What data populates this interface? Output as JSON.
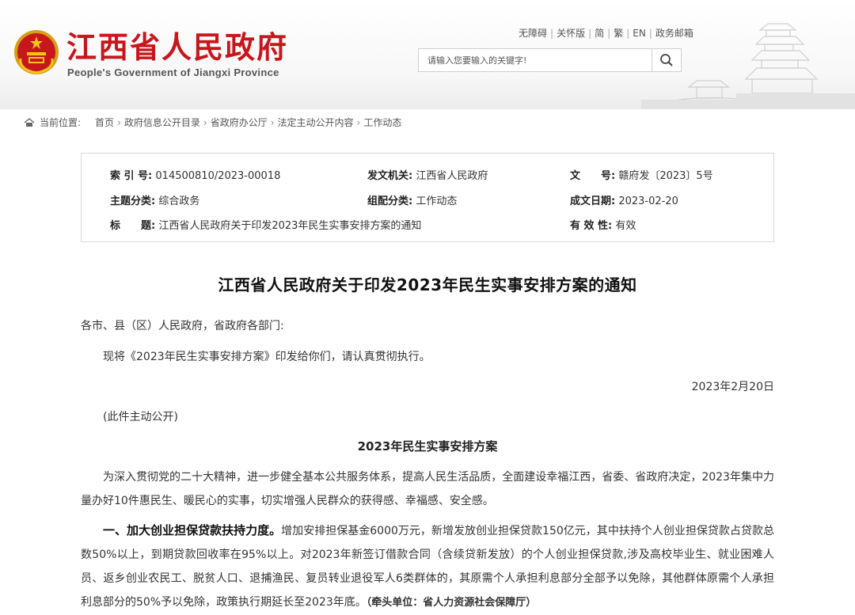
{
  "header": {
    "site_name": "江西省人民政府",
    "site_name_en": "People's Government of Jiangxi Province",
    "top_links": [
      "无障碍",
      "关怀版",
      "简",
      "繁",
      "EN",
      "政务邮箱"
    ],
    "search_placeholder": "请输入您要输入的关键字!"
  },
  "breadcrumb": {
    "label": "当前位置:",
    "items": [
      "首页",
      "政府信息公开目录",
      "省政府办公厅",
      "法定主动公开内容",
      "工作动态"
    ]
  },
  "meta": {
    "index_no_label": "索 引 号:",
    "index_no": "014500810/2023-00018",
    "issuer_label": "发文机关:",
    "issuer": "江西省人民政府",
    "doc_no_label": "文　　号:",
    "doc_no": "赣府发〔2023〕5号",
    "topic_label": "主题分类:",
    "topic": "综合政务",
    "category_label": "组配分类:",
    "category": "工作动态",
    "date_label": "成文日期:",
    "date": "2023-02-20",
    "title_label": "标　　题:",
    "title": "江西省人民政府关于印发2023年民生实事安排方案的通知",
    "validity_label": "有 效 性:",
    "validity": "有效"
  },
  "article": {
    "title": "江西省人民政府关于印发2023年民生实事安排方案的通知",
    "salutation": "各市、县（区）人民政府，省政府各部门:",
    "body": "现将《2023年民生实事安排方案》印发给你们，请认真贯彻执行。",
    "date": "2023年2月20日",
    "public_note": "(此件主动公开)",
    "sub_title": "2023年民生实事安排方案",
    "intro": "为深入贯彻党的二十大精神，进一步健全基本公共服务体系，提高人民生活品质，全面建设幸福江西，省委、省政府决定，2023年集中力量办好10件惠民生、暖民心的实事，切实增强人民群众的获得感、幸福感、安全感。",
    "item1_lead": "一、加大创业担保贷款扶持力度。",
    "item1_text": "增加安排担保基金6000万元，新增发放创业担保贷款150亿元，其中扶持个人创业担保贷款占贷款总数50%以上，到期贷款回收率在95%以上。对2023年新签订借款合同（含续贷新发放）的个人创业担保贷款,涉及高校毕业生、就业困难人员、返乡创业农民工、脱贫人口、退捕渔民、复员转业退役军人6类群体的，其原需个人承担利息部分全部予以免除，其他群体原需个人承担利息部分的50%予以免除，政策执行期延长至2023年底。",
    "item1_unit": "（牵头单位：省人力资源社会保障厅）"
  }
}
